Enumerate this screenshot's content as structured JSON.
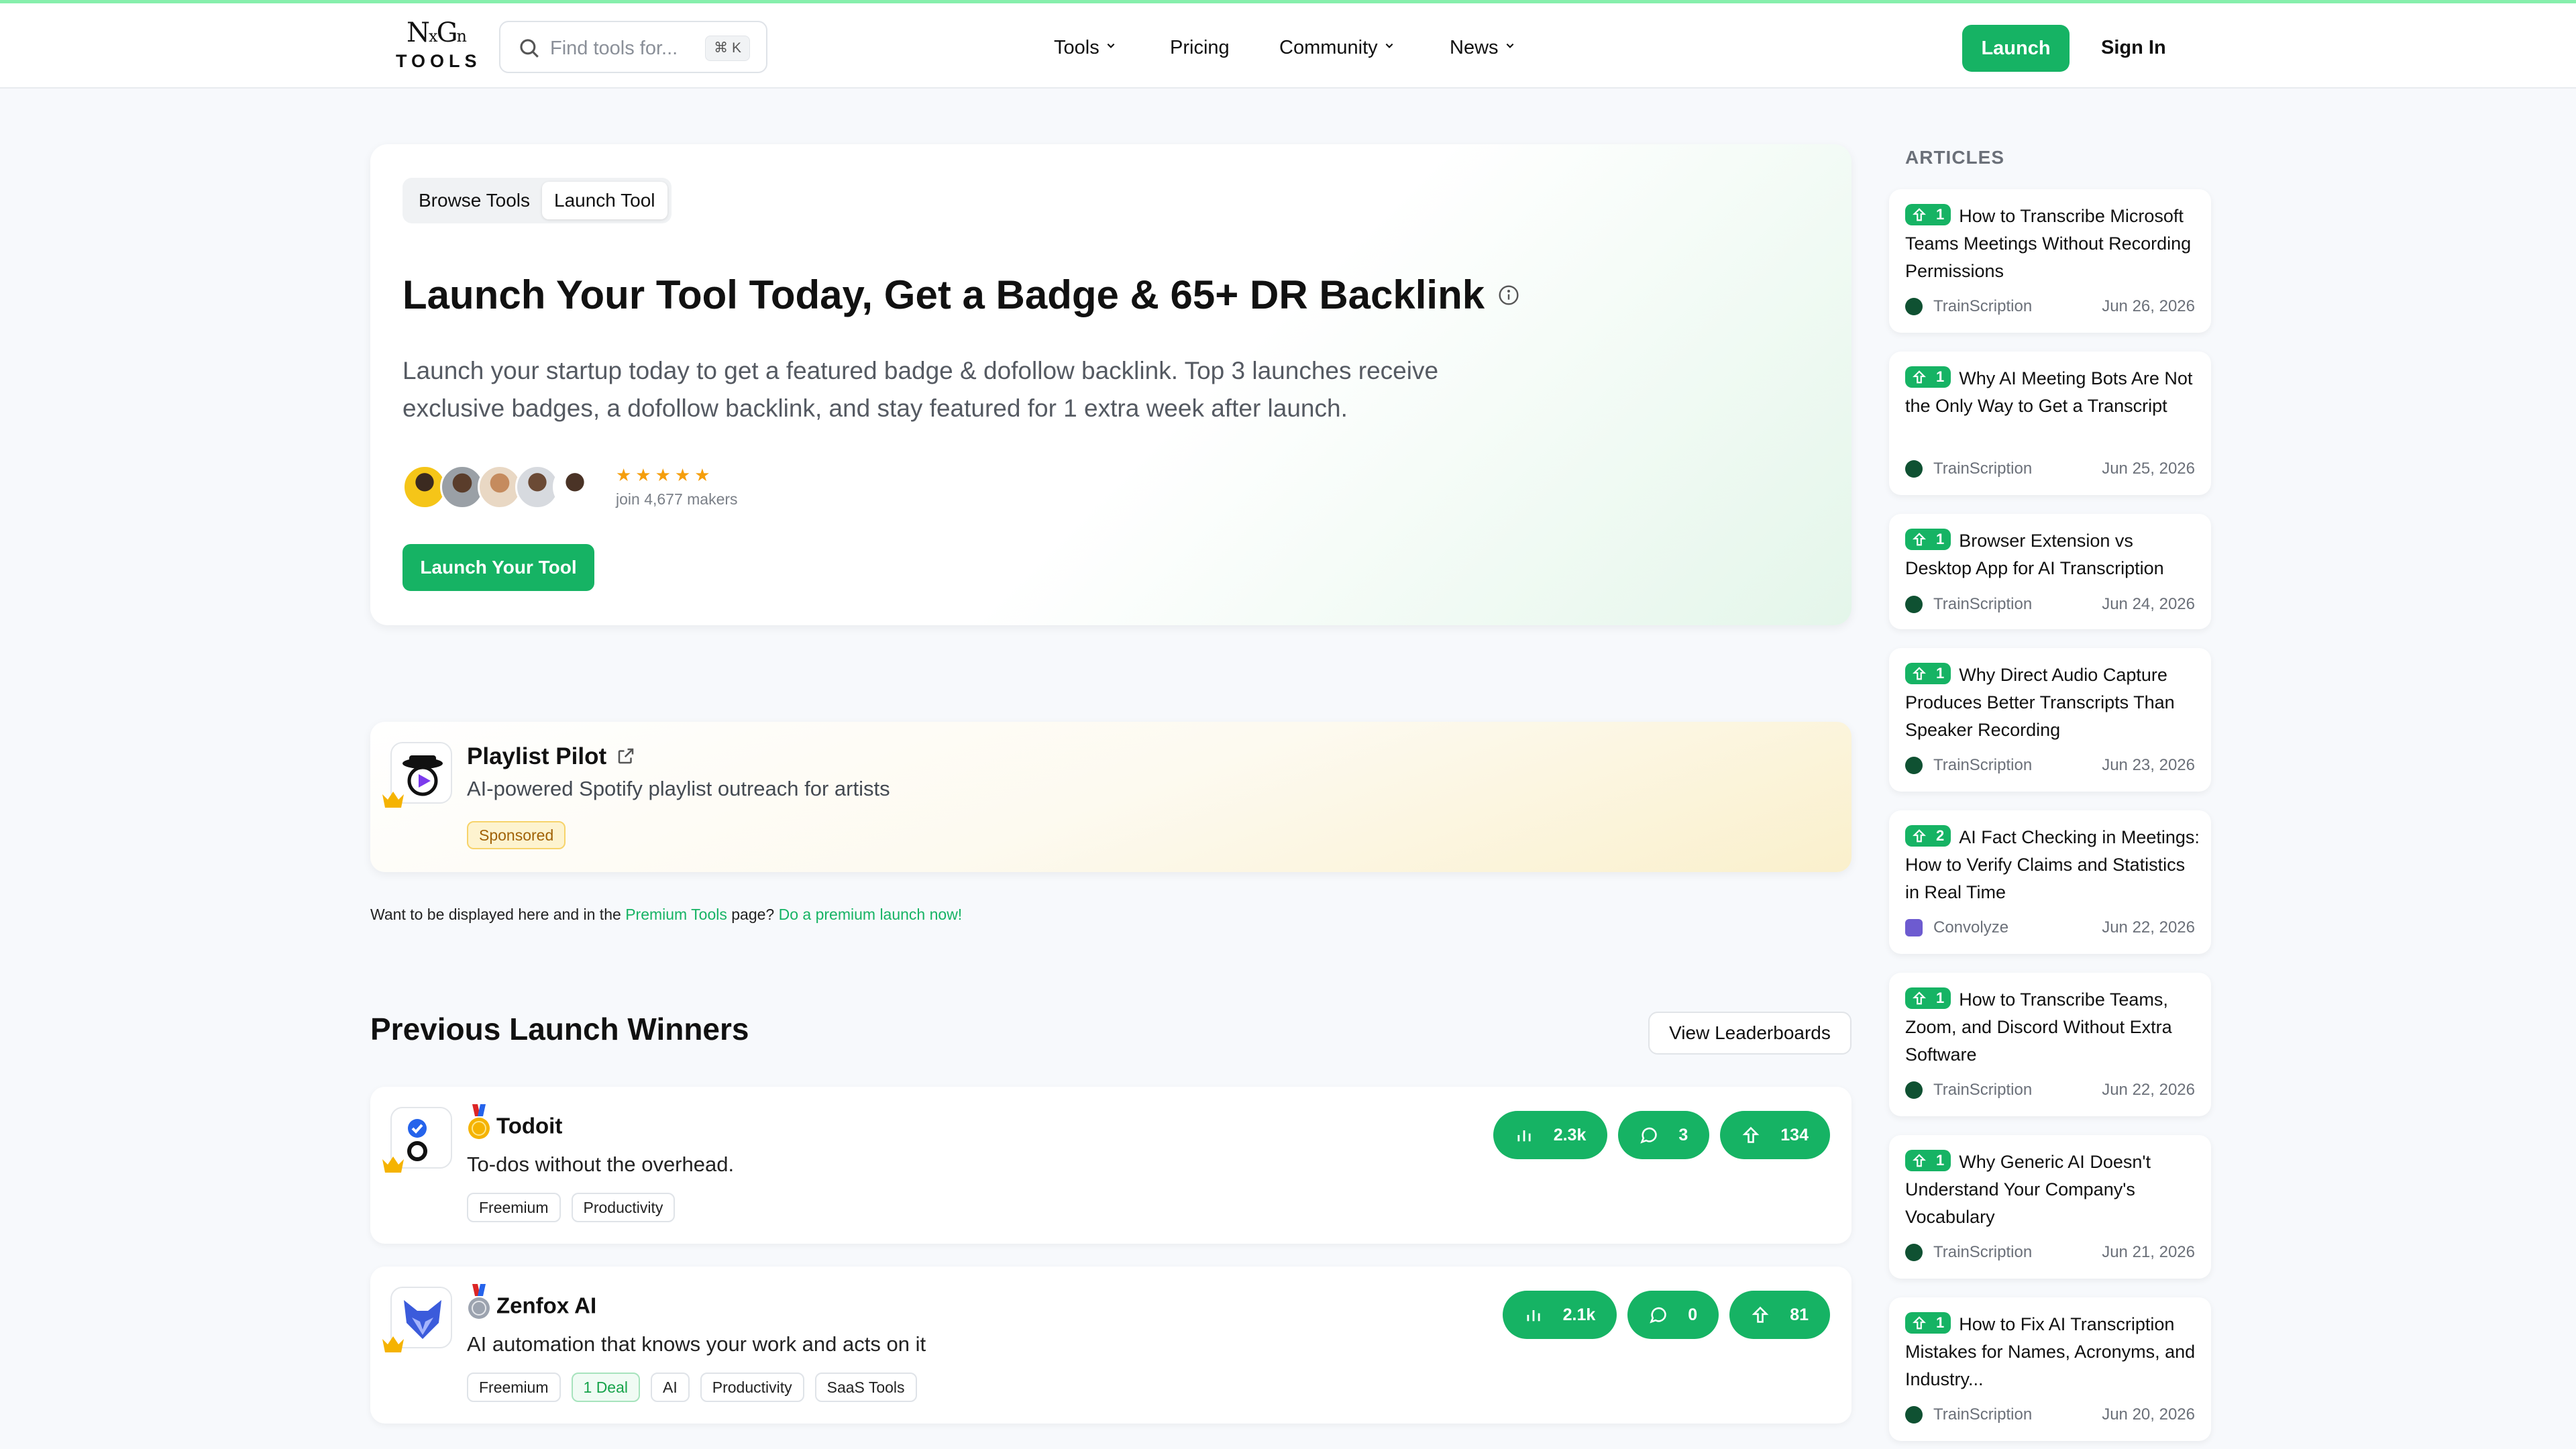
{
  "header": {
    "logo_top": "NxGn",
    "logo_bottom": "TOOLS",
    "search_placeholder": "Find tools for...",
    "search_shortcut": "⌘ K",
    "nav": [
      {
        "label": "Tools",
        "has_dropdown": true
      },
      {
        "label": "Pricing",
        "has_dropdown": false
      },
      {
        "label": "Community",
        "has_dropdown": true
      },
      {
        "label": "News",
        "has_dropdown": true
      }
    ],
    "launch_label": "Launch",
    "sign_in_label": "Sign In"
  },
  "hero": {
    "tabs": [
      "Browse Tools",
      "Launch Tool"
    ],
    "active_tab": "Launch Tool",
    "title": "Launch Your Tool Today, Get a Badge & 65+ DR Backlink",
    "description": "Launch your startup today to get a featured badge & dofollow backlink. Top 3 launches receive exclusive badges, a dofollow backlink, and stay featured for 1 extra week after launch.",
    "stars": "★★★★★",
    "makers_text": "join 4,677 makers",
    "cta_label": "Launch Your Tool"
  },
  "sponsored": {
    "name": "Playlist Pilot",
    "description": "AI-powered Spotify playlist outreach for artists",
    "badge": "Sponsored"
  },
  "premium_note": {
    "text_before": "Want to be displayed here and in the ",
    "link1": "Premium Tools",
    "text_middle": " page? ",
    "link2": "Do a premium launch now!"
  },
  "winners": {
    "title": "Previous Launch Winners",
    "leaderboard_label": "View Leaderboards",
    "items": [
      {
        "name": "Todoit",
        "medal": "gold",
        "description": "To-dos without the overhead.",
        "tags": [
          "Freemium",
          "Productivity"
        ],
        "views": "2.3k",
        "comments": "3",
        "upvotes": "134"
      },
      {
        "name": "Zenfox AI",
        "medal": "silver",
        "description": "AI automation that knows your work and acts on it",
        "tags": [
          "Freemium",
          "1 Deal",
          "AI",
          "Productivity",
          "SaaS Tools"
        ],
        "views": "2.1k",
        "comments": "0",
        "upvotes": "81"
      }
    ]
  },
  "articles": {
    "title": "ARTICLES",
    "items": [
      {
        "votes": "1",
        "title": "How to Transcribe Microsoft Teams Meetings Without Recording Permissions",
        "source": "TrainScription",
        "date": "Jun 26, 2026"
      },
      {
        "votes": "1",
        "title": "Why AI Meeting Bots Are Not the Only Way to Get a Transcript",
        "source": "TrainScription",
        "date": "Jun 25, 2026"
      },
      {
        "votes": "1",
        "title": "Browser Extension vs Desktop App for AI Transcription",
        "source": "TrainScription",
        "date": "Jun 24, 2026"
      },
      {
        "votes": "1",
        "title": "Why Direct Audio Capture Produces Better Transcripts Than Speaker Recording",
        "source": "TrainScription",
        "date": "Jun 23, 2026"
      },
      {
        "votes": "2",
        "title": "AI Fact Checking in Meetings: How to Verify Claims and Statistics in Real Time",
        "source": "Convolyze",
        "date": "Jun 22, 2026"
      },
      {
        "votes": "1",
        "title": "How to Transcribe Teams, Zoom, and Discord Without Extra Software",
        "source": "TrainScription",
        "date": "Jun 22, 2026"
      },
      {
        "votes": "1",
        "title": "Why Generic AI Doesn't Understand Your Company's Vocabulary",
        "source": "TrainScription",
        "date": "Jun 21, 2026"
      },
      {
        "votes": "1",
        "title": "How to Fix AI Transcription Mistakes for Names, Acronyms, and Industry...",
        "source": "TrainScription",
        "date": "Jun 20, 2026"
      }
    ]
  },
  "colors": {
    "accent": "#16b364",
    "background": "#f7f9fc",
    "sponsored_badge": "#fdf3cf"
  }
}
